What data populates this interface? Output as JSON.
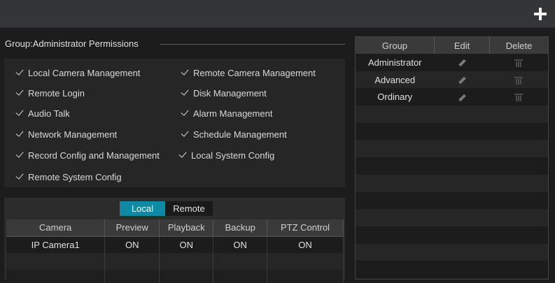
{
  "toolbar": {
    "add_icon": "plus-icon"
  },
  "permissions": {
    "title": "Group:Administrator Permissions",
    "items": [
      "Local Camera Management",
      "Remote Camera Management",
      "Remote Login",
      "Disk Management",
      "Audio Talk",
      "Alarm Management",
      "Network Management",
      "Schedule Management",
      "Record Config and Management",
      "Local System Config",
      "Remote System Config"
    ]
  },
  "camera_tabs": {
    "local": "Local",
    "remote": "Remote",
    "active": "Local"
  },
  "camera_table": {
    "headers": [
      "Camera",
      "Preview",
      "Playback",
      "Backup",
      "PTZ Control"
    ],
    "rows": [
      [
        "IP Camera1",
        "ON",
        "ON",
        "ON",
        "ON"
      ]
    ]
  },
  "group_table": {
    "headers": [
      "Group",
      "Edit",
      "Delete"
    ],
    "rows": [
      {
        "name": "Administrator"
      },
      {
        "name": "Advanced"
      },
      {
        "name": "Ordinary"
      }
    ]
  },
  "colors": {
    "accent": "#0f8aa5",
    "background": "#1c1c1c",
    "header": "#3a3a3a"
  }
}
